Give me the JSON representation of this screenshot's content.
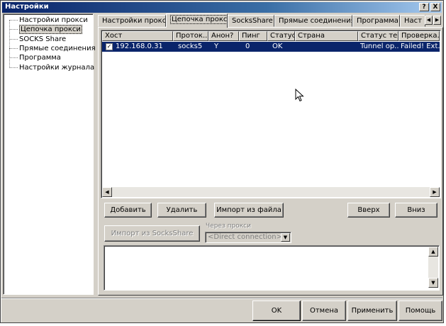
{
  "window": {
    "title": "Настройки",
    "help_button": "?",
    "close_button": "X"
  },
  "sidebar": {
    "items": [
      {
        "label": "Настройки прокси"
      },
      {
        "label": "Цепочка прокси"
      },
      {
        "label": "SOCKS Share"
      },
      {
        "label": "Прямые соединения"
      },
      {
        "label": "Программа"
      },
      {
        "label": "Настройки журнала"
      }
    ],
    "selected": "Цепочка прокси"
  },
  "tabs": {
    "items": [
      {
        "label": "Настройки прокси"
      },
      {
        "label": "Цепочка прокси"
      },
      {
        "label": "SocksShare"
      },
      {
        "label": "Прямые соединения"
      },
      {
        "label": "Программа"
      },
      {
        "label": "Наст"
      }
    ],
    "active": "Цепочка прокси",
    "scroll_left": "◀",
    "scroll_right": "▶"
  },
  "table": {
    "columns": [
      "Хост",
      "Проток...",
      "Анон?",
      "Пинг",
      "Статус",
      "Страна",
      "Статус те...",
      "Проверка..."
    ],
    "rows": [
      {
        "checked": true,
        "check_mark": "✓",
        "cells": [
          "192.168.0.31",
          "socks5",
          "Y",
          "0",
          "OK",
          "",
          "Tunnel op...",
          "Failed! Ext..."
        ]
      }
    ],
    "scroll_left": "◀",
    "scroll_right": "▶"
  },
  "buttons": {
    "add": "Добавить",
    "delete": "Удалить",
    "import_file": "Импорт из файла",
    "up": "Вверх",
    "down": "Вниз",
    "import_socksshare": "Импорт из SocksShare",
    "ok": "OK",
    "cancel": "Отмена",
    "apply": "Применить",
    "help": "Помощь"
  },
  "via_proxy": {
    "label": "Через прокси",
    "value": "<Direct connection>",
    "arrow": "▼"
  },
  "memo": {
    "scroll_up": "▲",
    "scroll_down": "▼"
  }
}
